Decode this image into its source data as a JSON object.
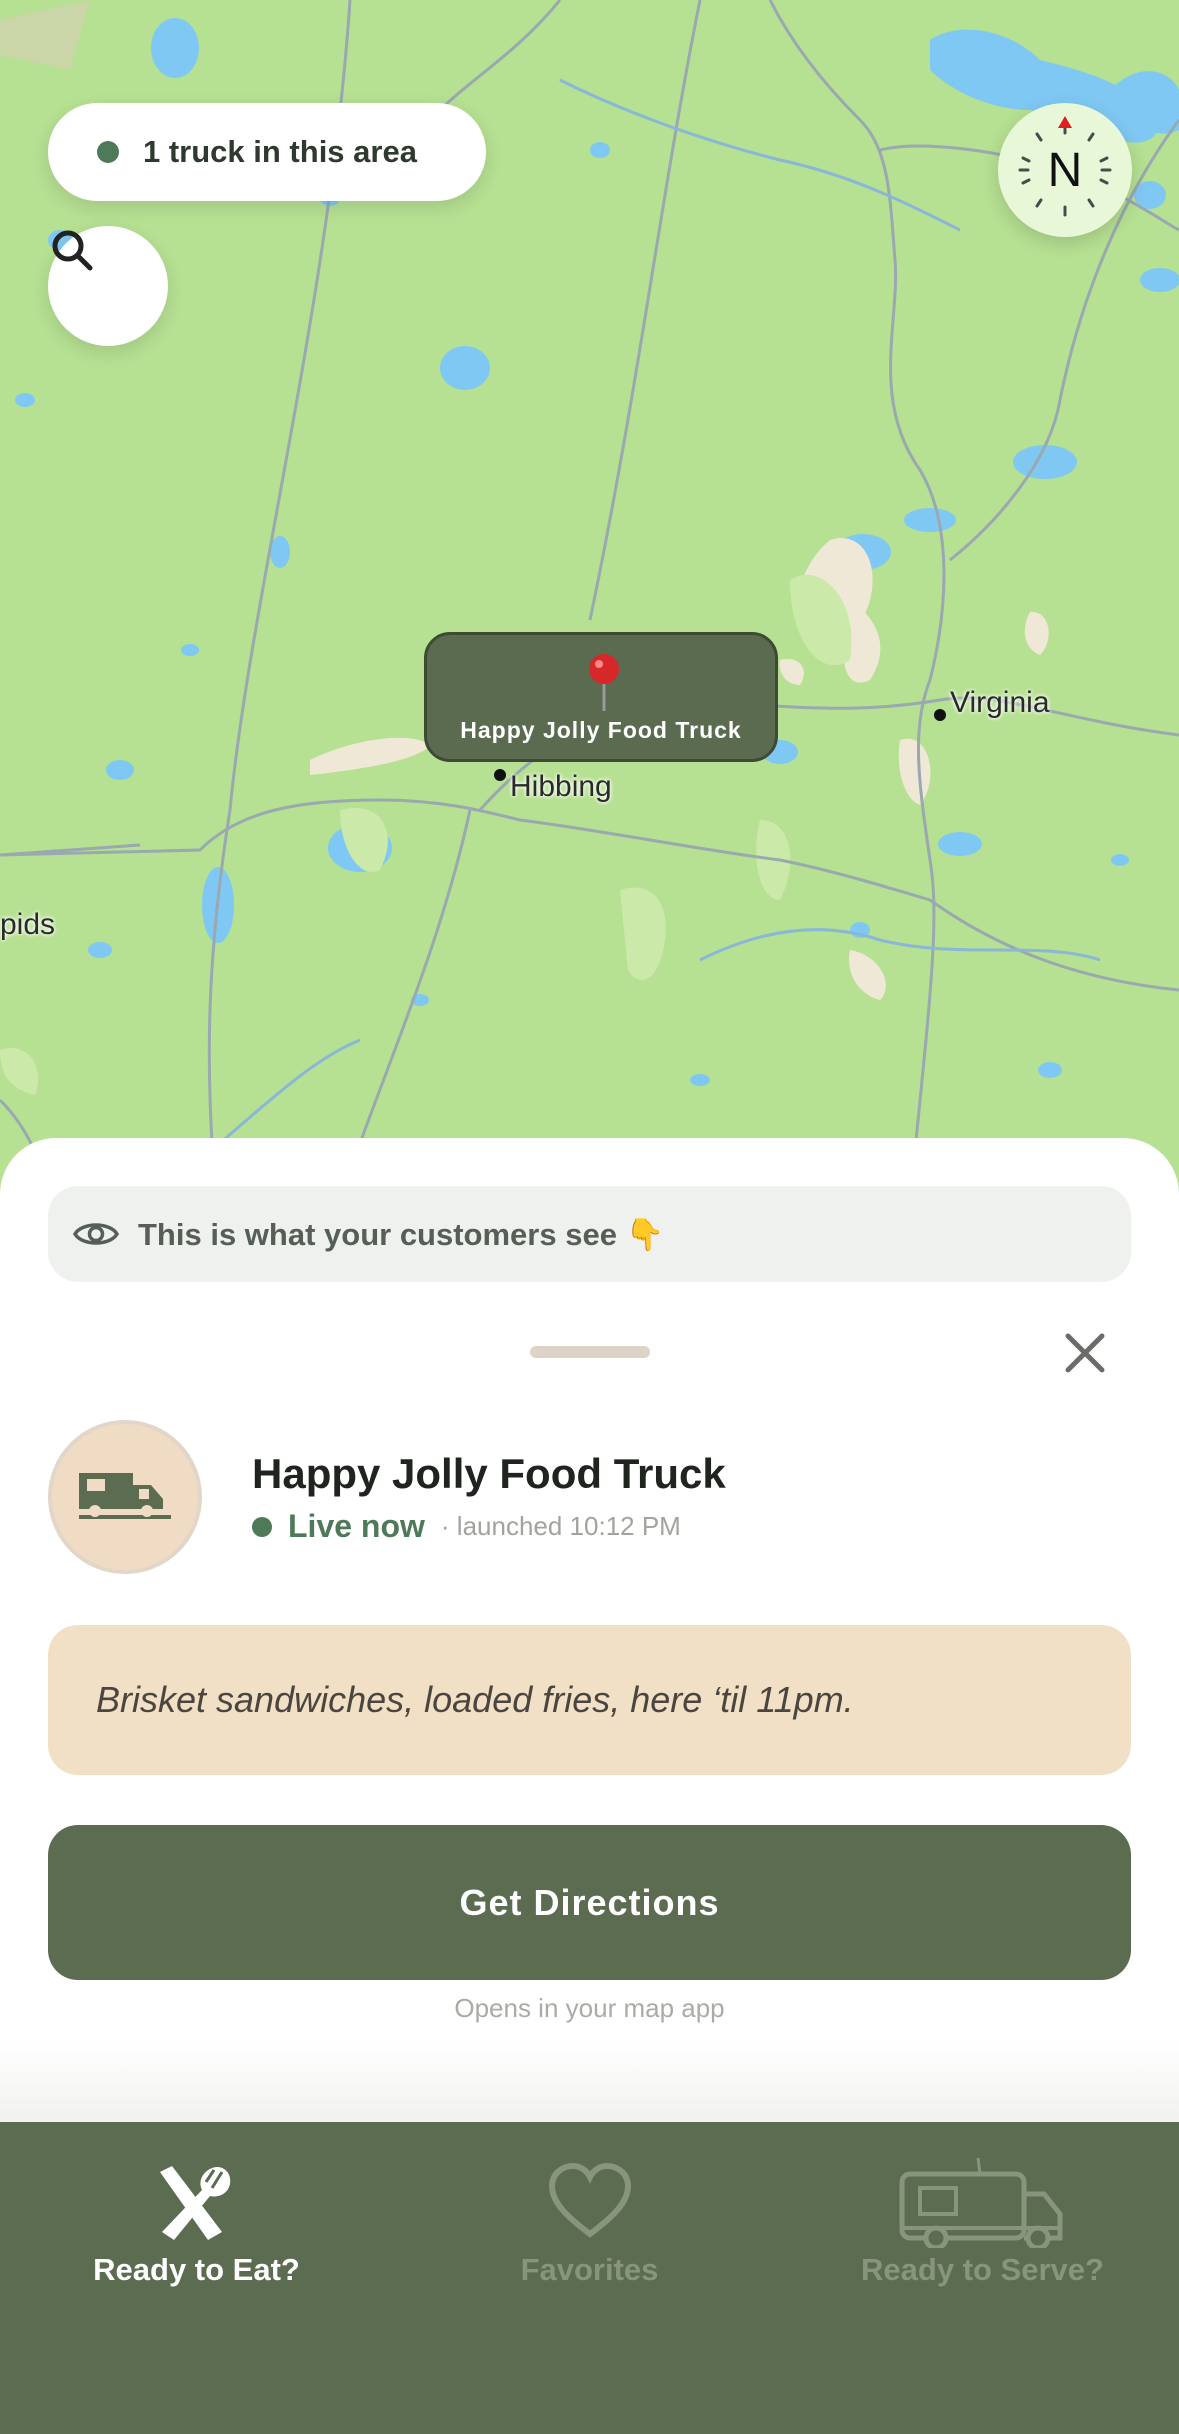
{
  "map": {
    "area_pill": "1 truck in this area",
    "compass_letter": "N",
    "marker_label": "Happy Jolly Food Truck",
    "cities": [
      "Hibbing",
      "Virginia",
      "pids"
    ]
  },
  "sheet": {
    "info_banner": "This is what your customers see 👇",
    "truck": {
      "name": "Happy Jolly Food Truck",
      "status": "Live now",
      "launched": "· launched 10:12 PM",
      "special": "Brisket sandwiches, loaded fries, here ‘til 11pm."
    },
    "directions_label": "Get Directions",
    "directions_hint": "Opens in your map app"
  },
  "tabs": [
    {
      "label": "Ready to Eat?",
      "icon": "utensils-icon",
      "active": true
    },
    {
      "label": "Favorites",
      "icon": "heart-icon",
      "active": false
    },
    {
      "label": "Ready to Serve?",
      "icon": "truck-icon",
      "active": false
    }
  ],
  "colors": {
    "brand_green": "#5b6c50",
    "live_green": "#4f7a5a",
    "map_land": "#b6e092",
    "special_bg": "#f1dfc6"
  }
}
